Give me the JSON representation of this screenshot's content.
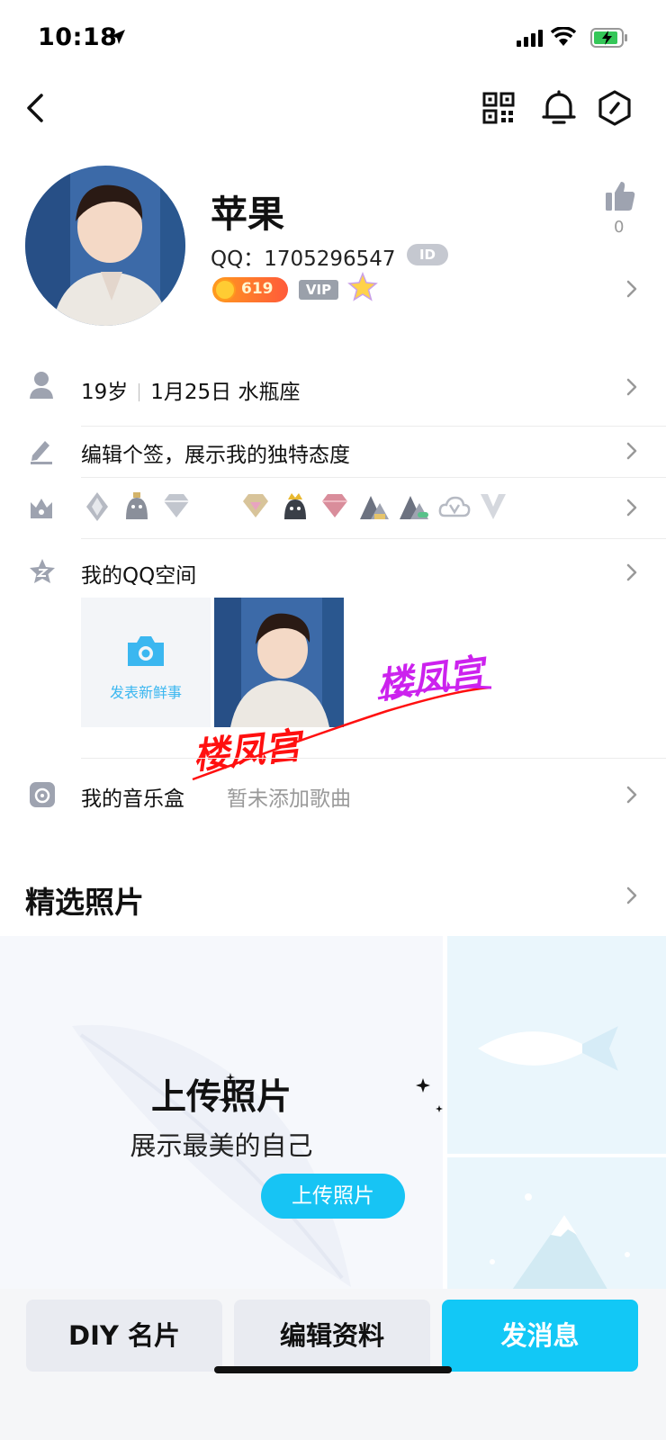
{
  "status_bar": {
    "time": "10:18"
  },
  "profile": {
    "name": "苹果",
    "qq_label": "QQ：",
    "qq_number": "1705296547",
    "id_badge": "ID",
    "coin_value": "619",
    "vip_label": "VIP",
    "likes": "0"
  },
  "rows": {
    "age": "19岁",
    "birthday": "1月25日 水瓶座",
    "signature": "编辑个签，展示我的独特态度",
    "qzone": "我的QQ空间",
    "post_new": "发表新鲜事",
    "music": "我的音乐盒",
    "music_status": "暂未添加歌曲"
  },
  "watermark": {
    "text_left": "楼凤宫",
    "text_right": "楼凤宫"
  },
  "featured": {
    "title": "精选照片",
    "upload_title": "上传照片",
    "upload_subtitle": "展示最美的自己",
    "upload_button": "上传照片"
  },
  "bottom_bar": {
    "diy": "DIY 名片",
    "edit": "编辑资料",
    "message": "发消息"
  },
  "colors": {
    "accent": "#12c8f6",
    "icon_gray": "#8a8fa0",
    "watermark_red": "#ff1010",
    "watermark_purple": "#cc22ee"
  },
  "icons": [
    "location-arrow-icon",
    "signal-icon",
    "wifi-icon",
    "battery-icon",
    "back-icon",
    "qr-code-icon",
    "bell-icon",
    "settings-icon",
    "thumbs-up-icon",
    "chevron-right-icon",
    "person-icon",
    "pen-icon",
    "crown-icon",
    "qzone-star-icon",
    "camera-icon",
    "music-icon"
  ]
}
